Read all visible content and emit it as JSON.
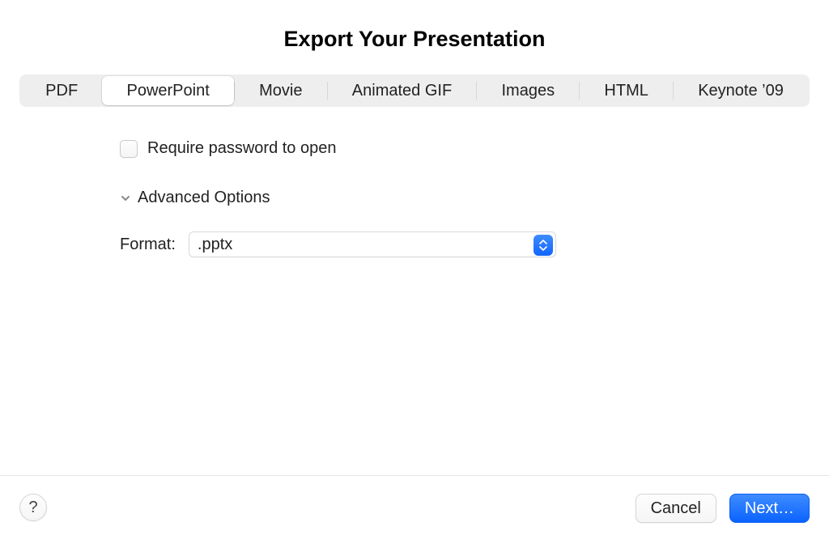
{
  "title": "Export Your Presentation",
  "tabs": [
    {
      "label": "PDF"
    },
    {
      "label": "PowerPoint",
      "active": true
    },
    {
      "label": "Movie"
    },
    {
      "label": "Animated GIF"
    },
    {
      "label": "Images"
    },
    {
      "label": "HTML"
    },
    {
      "label": "Keynote ’09"
    }
  ],
  "options": {
    "require_password_label": "Require password to open",
    "require_password_checked": false,
    "advanced_label": "Advanced Options",
    "advanced_expanded": true,
    "format_label": "Format:",
    "format_selected": ".pptx"
  },
  "footer": {
    "help_label": "?",
    "cancel_label": "Cancel",
    "next_label": "Next…"
  },
  "colors": {
    "accent": "#0a63ff",
    "segmented_bg": "#eeeeef"
  }
}
